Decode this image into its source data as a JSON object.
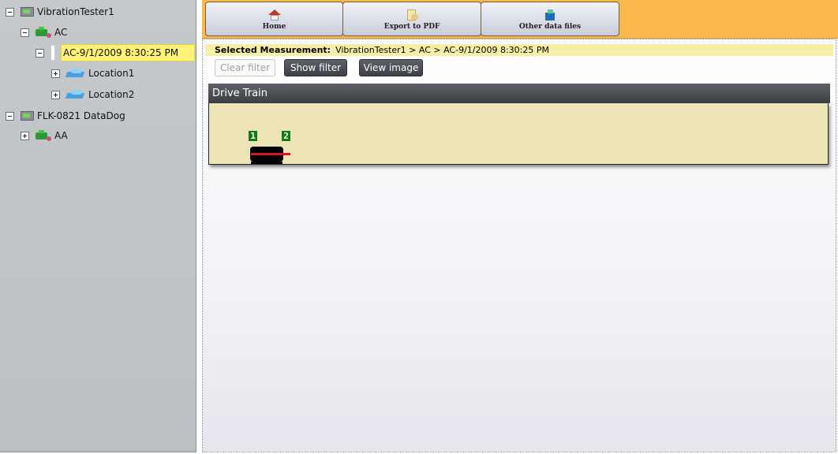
{
  "tree": {
    "nodes": [
      {
        "label": "VibrationTester1",
        "toggle": "minus",
        "icon": "device-icon"
      },
      {
        "label": "AC",
        "toggle": "minus",
        "icon": "machine-icon"
      },
      {
        "label": "AC-9/1/2009 8:30:25 PM",
        "toggle": "minus",
        "icon": "measurement-icon",
        "selected": true
      },
      {
        "label": "Location1",
        "toggle": "plus",
        "icon": "location-icon"
      },
      {
        "label": "Location2",
        "toggle": "plus",
        "icon": "location-icon"
      },
      {
        "label": "FLK-0821 DataDog",
        "toggle": "minus",
        "icon": "device-icon"
      },
      {
        "label": "AA",
        "toggle": "plus",
        "icon": "machine-icon"
      }
    ]
  },
  "toolbar": {
    "home_label": "Home",
    "export_label": "Export to PDF",
    "files_label": "Other data files",
    "accent_color": "#fbb74b"
  },
  "selection": {
    "prefix": "Selected Measurement:",
    "path": "VibrationTester1 > AC > AC-9/1/2009 8:30:25 PM"
  },
  "filters": {
    "clear_label": "Clear filter",
    "show_label": "Show filter",
    "view_label": "View image"
  },
  "drive_train": {
    "title": "Drive Train",
    "points": [
      "1",
      "2"
    ]
  }
}
